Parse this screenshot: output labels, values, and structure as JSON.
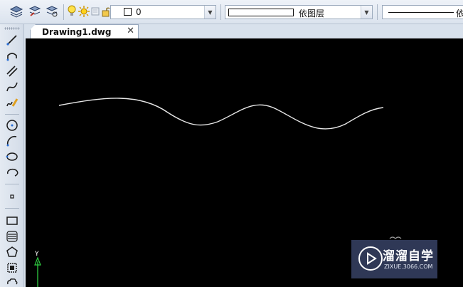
{
  "layer": {
    "name": "0"
  },
  "color": {
    "label": "依图层"
  },
  "linetype": {
    "label": "依"
  },
  "tab": {
    "title": "Drawing1.dwg",
    "close_glyph": "✕"
  },
  "ucs": {
    "y_label": "Y"
  },
  "watermark": {
    "title": "溜溜自学",
    "url": "ZIXUE.3066.COM"
  },
  "colors": {
    "canvas": "#000000",
    "curve": "#e8e8e8",
    "ucs_axis": "#2ecc40",
    "toolbar": "#dbe3ee"
  }
}
